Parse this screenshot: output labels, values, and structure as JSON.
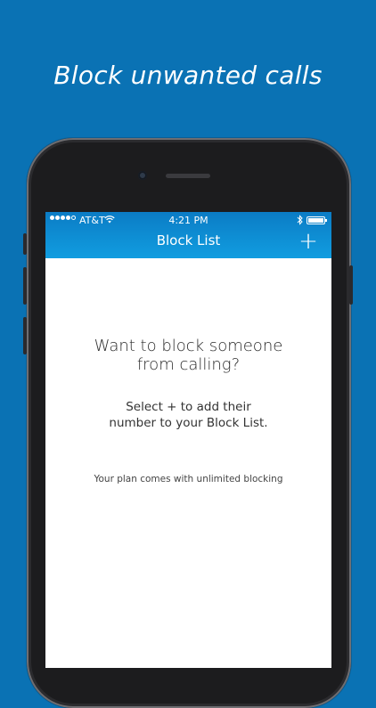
{
  "headline": "Block unwanted calls",
  "status_bar": {
    "carrier": "AT&T",
    "time": "4:21 PM",
    "signal_dots_filled": 4,
    "signal_dots_total": 5
  },
  "nav": {
    "title": "Block List",
    "add_label": "+"
  },
  "empty_state": {
    "title_line1": "Want to block someone",
    "title_line2": "from calling?",
    "sub_line1": "Select + to add their",
    "sub_line2": "number to your Block List.",
    "plan_note": "Your plan comes with unlimited blocking"
  },
  "colors": {
    "background": "#0a72b4",
    "nav_gradient_top": "#0b7cc5",
    "nav_gradient_bottom": "#119de0"
  },
  "icons": [
    "wifi-icon",
    "bluetooth-icon",
    "battery-icon",
    "plus-icon"
  ]
}
